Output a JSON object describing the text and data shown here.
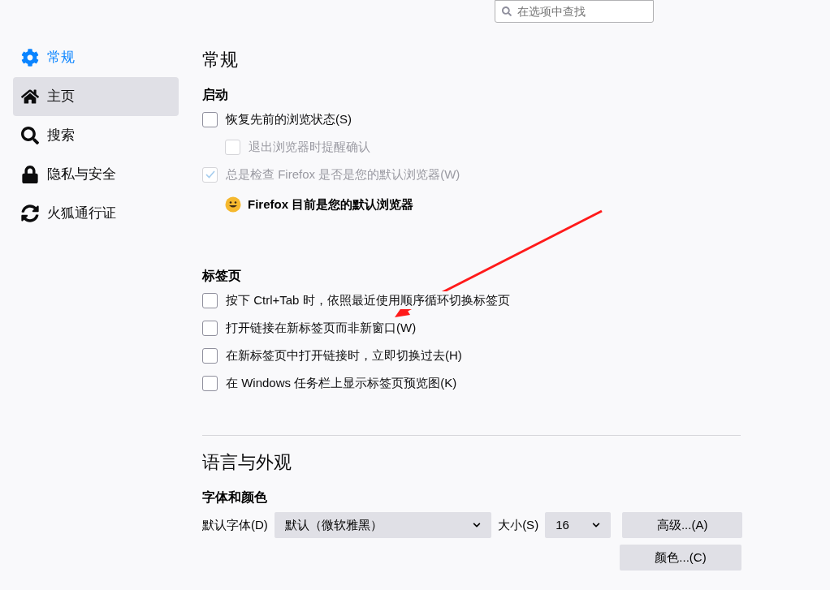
{
  "search": {
    "placeholder": "在选项中查找"
  },
  "sidebar": {
    "items": [
      {
        "label": "常规",
        "selected": true,
        "hovered": false
      },
      {
        "label": "主页",
        "selected": false,
        "hovered": true
      },
      {
        "label": "搜索",
        "selected": false,
        "hovered": false
      },
      {
        "label": "隐私与安全",
        "selected": false,
        "hovered": false
      },
      {
        "label": "火狐通行证",
        "selected": false,
        "hovered": false
      }
    ]
  },
  "general": {
    "title": "常规",
    "startup": {
      "heading": "启动",
      "options": [
        {
          "label": "恢复先前的浏览状态(S)",
          "checked": false,
          "disabled": false,
          "children": [
            {
              "label": "退出浏览器时提醒确认",
              "checked": false,
              "disabled": true
            }
          ]
        },
        {
          "label": "总是检查 Firefox 是否是您的默认浏览器(W)",
          "checked": true,
          "disabled": true
        }
      ],
      "default_status": "Firefox 目前是您的默认浏览器"
    },
    "tabs": {
      "heading": "标签页",
      "options": [
        {
          "label": "按下 Ctrl+Tab 时，依照最近使用顺序循环切换标签页",
          "checked": false,
          "disabled": false
        },
        {
          "label": "打开链接在新标签页而非新窗口(W)",
          "checked": false,
          "disabled": false
        },
        {
          "label": "在新标签页中打开链接时，立即切换过去(H)",
          "checked": false,
          "disabled": false
        },
        {
          "label": "在 Windows 任务栏上显示标签页预览图(K)",
          "checked": false,
          "disabled": false
        }
      ]
    }
  },
  "language": {
    "title": "语言与外观",
    "fonts": {
      "heading": "字体和颜色",
      "font_label": "默认字体(D)",
      "font_value": "默认（微软雅黑）",
      "size_label": "大小(S)",
      "size_value": "16",
      "advanced_button": "高级...(A)",
      "colors_button": "颜色...(C)"
    }
  }
}
